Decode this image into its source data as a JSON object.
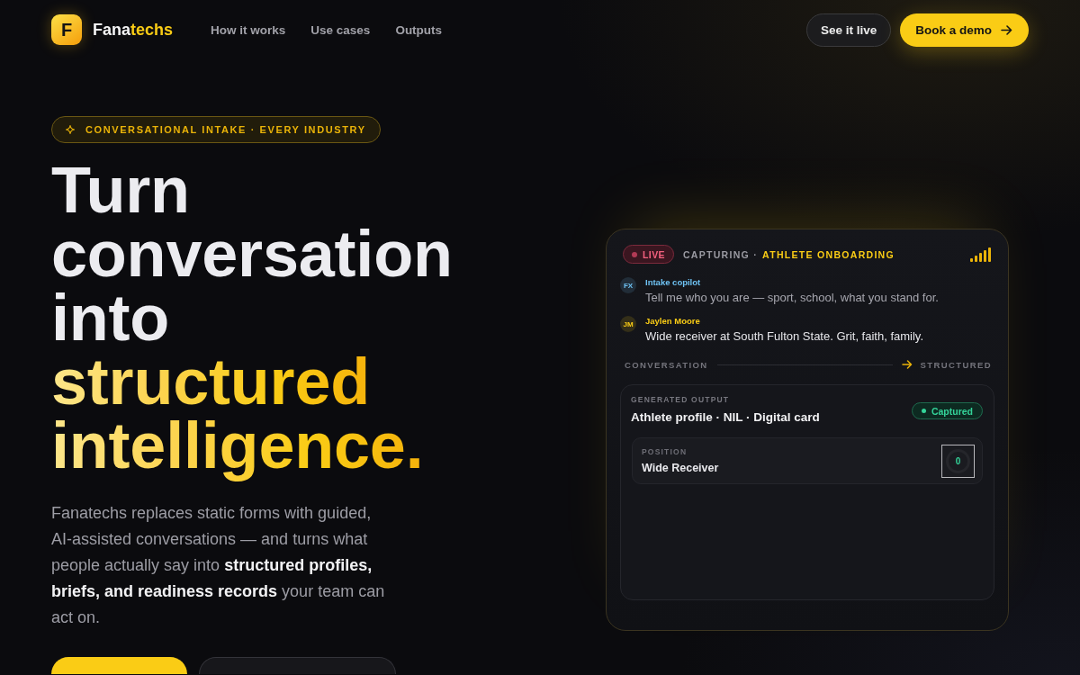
{
  "nav": {
    "brand": {
      "mark": "F",
      "name_start": "Fana",
      "name_end": "techs"
    },
    "links": [
      "How it works",
      "Use cases",
      "Outputs"
    ],
    "actions": [
      {
        "label": "See it live",
        "kind": "secondary"
      },
      {
        "label": "Book a demo",
        "kind": "primary"
      }
    ]
  },
  "hero": {
    "badge": "CONVERSATIONAL INTAKE · EVERY INDUSTRY",
    "headline": {
      "plain": "Turn conversation into",
      "accent": "structured intelligence."
    },
    "lede": "Fanatechs replaces static forms with guided, AI-assisted conversations — and turns what people actually say into **structured profiles, briefs, and readiness records** your team can act on.",
    "cta_buttons": [
      {
        "kind": "primary"
      },
      {
        "kind": "secondary"
      }
    ]
  },
  "card": {
    "live": "LIVE",
    "status": "CAPTURING ·",
    "flow": "ATHLETE ONBOARDING",
    "messages": [
      {
        "initials": "FX",
        "sender": "Intake copilot",
        "text": "Tell me who you are — sport, school, what you stand for.",
        "outgoing": false,
        "color": "#6ec1f2"
      },
      {
        "initials": "JM",
        "sender": "Jaylen Moore",
        "text": "Wide receiver at South Fulton State. Grit, faith, family.",
        "outgoing": true,
        "color": "#facc15"
      }
    ],
    "transition": {
      "from": "CONVERSATION",
      "to": "STRUCTURED"
    },
    "output": {
      "eyebrow": "GENERATED OUTPUT",
      "title": "Athlete profile · NIL · Digital card",
      "status": "Captured",
      "fields": [
        {
          "label": "POSITION",
          "value": "Wide Receiver",
          "score": "0"
        }
      ]
    }
  }
}
